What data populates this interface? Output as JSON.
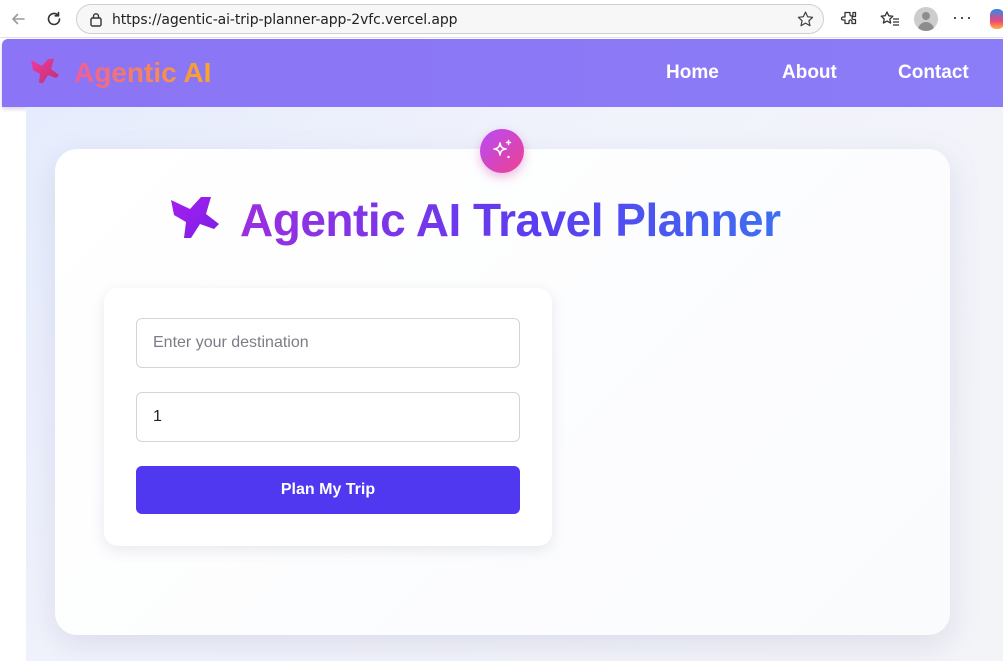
{
  "browser": {
    "url": "https://agentic-ai-trip-planner-app-2vfc.vercel.app",
    "icons": [
      "back-arrow-icon",
      "reload-icon",
      "lock-icon",
      "star-icon",
      "extensions-icon",
      "favorites-icon",
      "profile-avatar",
      "more-icon",
      "copilot-icon"
    ]
  },
  "nav": {
    "brand": "Agentic AI",
    "links": [
      "Home",
      "About",
      "Contact"
    ],
    "brand_icon": "airplane-icon",
    "colors": {
      "bar": "#8b74f5",
      "brand_gradient_start": "#f15c97",
      "brand_gradient_end": "#f9a826"
    }
  },
  "main": {
    "badge_icon": "sparkle-icon",
    "title": "Agentic AI Travel Planner",
    "title_icon": "airplane-icon",
    "form": {
      "destination_placeholder": "Enter your destination",
      "destination_value": "",
      "days_value": "1",
      "submit_label": "Plan My Trip"
    },
    "colors": {
      "button": "#4f38f0",
      "title_gradient_start": "#9b2fe0",
      "title_gradient_end": "#3d6ff2"
    }
  }
}
